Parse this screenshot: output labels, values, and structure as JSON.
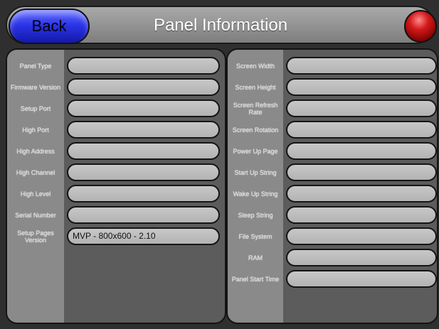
{
  "header": {
    "back_label": "Back",
    "title": "Panel Information"
  },
  "left_panel": {
    "rows": [
      {
        "label": "Panel Type",
        "value": ""
      },
      {
        "label": "Firmware Version",
        "value": ""
      },
      {
        "label": "Setup Port",
        "value": ""
      },
      {
        "label": "High Port",
        "value": ""
      },
      {
        "label": "High Address",
        "value": ""
      },
      {
        "label": "High Channel",
        "value": ""
      },
      {
        "label": "High Level",
        "value": ""
      },
      {
        "label": "Serial Number",
        "value": ""
      },
      {
        "label": "Setup Pages Version",
        "value": "MVP - 800x600 - 2.10"
      }
    ]
  },
  "right_panel": {
    "rows": [
      {
        "label": "Screen Width",
        "value": ""
      },
      {
        "label": "Screen Height",
        "value": ""
      },
      {
        "label": "Screen Refresh Rate",
        "value": ""
      },
      {
        "label": "Screen Rotation",
        "value": ""
      },
      {
        "label": "Power Up Page",
        "value": ""
      },
      {
        "label": "Start Up String",
        "value": ""
      },
      {
        "label": "Wake Up String",
        "value": ""
      },
      {
        "label": "Sleep String",
        "value": ""
      },
      {
        "label": "File System",
        "value": ""
      },
      {
        "label": "RAM",
        "value": ""
      },
      {
        "label": "Panel Start Time",
        "value": ""
      }
    ]
  },
  "colors": {
    "back_button": "#2c35e8",
    "power_button": "#d31a1a"
  },
  "icons": {
    "power": "power-button-icon"
  }
}
